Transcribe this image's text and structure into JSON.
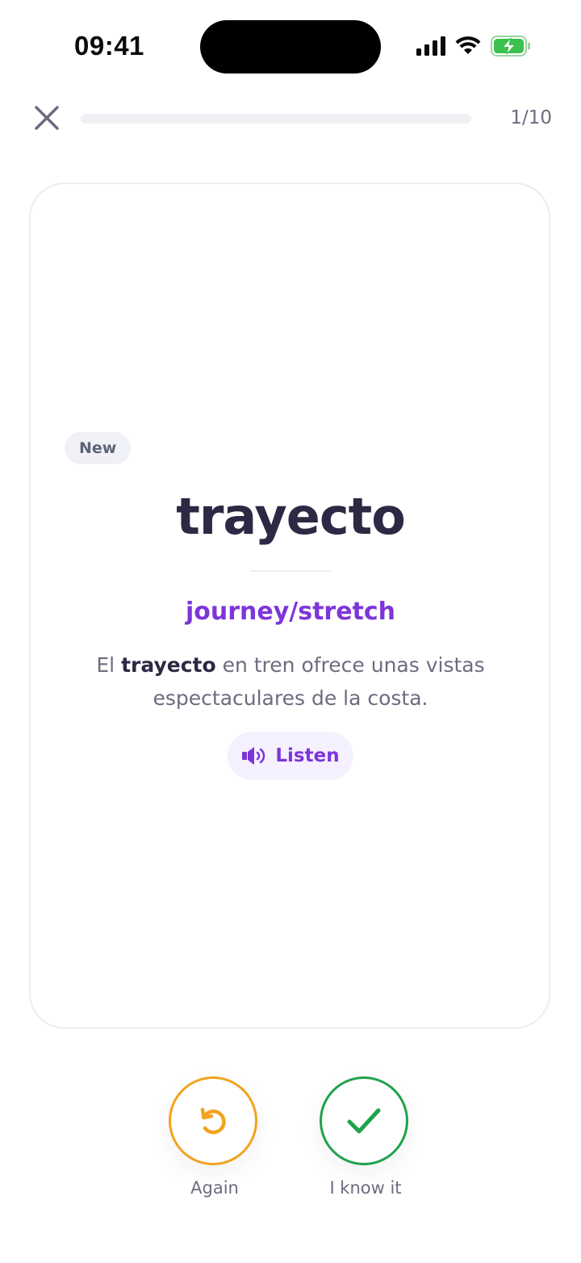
{
  "status_bar": {
    "time": "09:41",
    "icons": [
      "cellular-signal-icon",
      "wifi-icon",
      "battery-charging-icon"
    ]
  },
  "top_bar": {
    "close_icon": "close-icon",
    "progress": {
      "current": 1,
      "total": 10,
      "fraction": 0.0
    },
    "counter": "1/10"
  },
  "card": {
    "badge": "New",
    "word": "trayecto",
    "translation": "journey/stretch",
    "example": {
      "before": "El ",
      "highlight": "trayecto",
      "after": " en tren ofrece unas vistas espectaculares de la costa."
    },
    "listen": {
      "label": "Listen",
      "icon": "speaker-icon"
    }
  },
  "actions": {
    "again": {
      "label": "Again",
      "icon": "undo-icon"
    },
    "know": {
      "label": "I know it",
      "icon": "checkmark-icon"
    }
  },
  "colors": {
    "accent": "#7d35db",
    "again": "#f1a31e",
    "know": "#1fa24a",
    "text": "#2d2944",
    "muted": "#6d6b80"
  }
}
